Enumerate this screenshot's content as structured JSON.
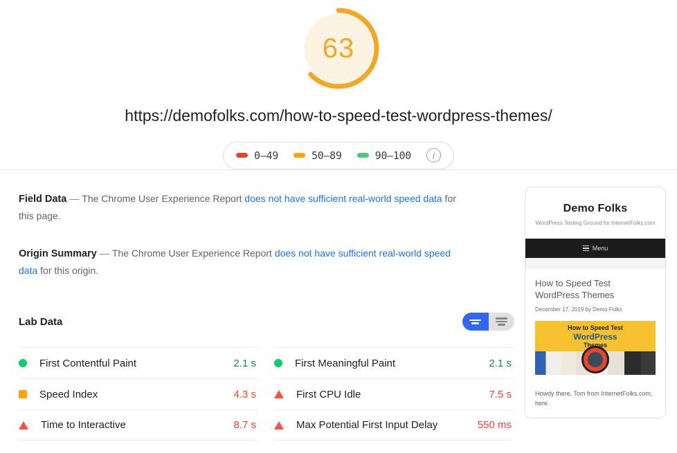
{
  "score": {
    "value": "63",
    "percent": 63,
    "arc_color": "#f5a623",
    "track_color": "#fdf3e3"
  },
  "url": "https://demofolks.com/how-to-speed-test-wordpress-themes/",
  "legend": {
    "items": [
      {
        "label": "0–49",
        "color": "#e8412c",
        "icon": "dash-icon"
      },
      {
        "label": "50–89",
        "color": "#ffa400",
        "icon": "dash-icon"
      },
      {
        "label": "90–100",
        "color": "#4ec77f",
        "icon": "dash-icon"
      }
    ],
    "info_icon": "info-icon",
    "info_glyph": "i"
  },
  "field_data": {
    "title": "Field Data",
    "dash": "—",
    "text_before": "The Chrome User Experience Report ",
    "link": "does not have sufficient real-world speed data",
    "text_after": " for this page."
  },
  "origin_summary": {
    "title": "Origin Summary",
    "dash": "—",
    "text_before": "The Chrome User Experience Report ",
    "link": "does not have sufficient real-world speed data",
    "text_after": " for this origin."
  },
  "lab_data": {
    "title": "Lab Data",
    "view_toggle": {
      "active": "grid-view-button",
      "inactive": "list-view-button"
    },
    "columns": [
      {
        "rows": [
          {
            "status": "pass",
            "name": "First Contentful Paint",
            "value": "2.1 s",
            "icon": "circle-icon"
          },
          {
            "status": "avg",
            "name": "Speed Index",
            "value": "4.3 s",
            "icon": "square-icon"
          },
          {
            "status": "fail",
            "name": "Time to Interactive",
            "value": "8.7 s",
            "icon": "triangle-icon"
          }
        ]
      },
      {
        "rows": [
          {
            "status": "pass",
            "name": "First Meaningful Paint",
            "value": "2.1 s",
            "icon": "circle-icon"
          },
          {
            "status": "fail",
            "name": "First CPU Idle",
            "value": "7.5 s",
            "icon": "triangle-icon"
          },
          {
            "status": "fail",
            "name": "Max Potential First Input Delay",
            "value": "550 ms",
            "icon": "triangle-icon"
          }
        ]
      }
    ]
  },
  "preview": {
    "site_title": "Demo Folks",
    "tagline": "WordPress Testing Ground for InternetFolks.com",
    "menu_label": "Menu",
    "article_title": "How to Speed Test WordPress Themes",
    "article_meta": "December 17, 2019 by Demo Folks",
    "featured_image": {
      "line1": "How to Speed Test",
      "line2": "WordPress",
      "line3": "Themes"
    },
    "footer_text": "Howdy there, Tom from InternetFolks.com, here."
  }
}
